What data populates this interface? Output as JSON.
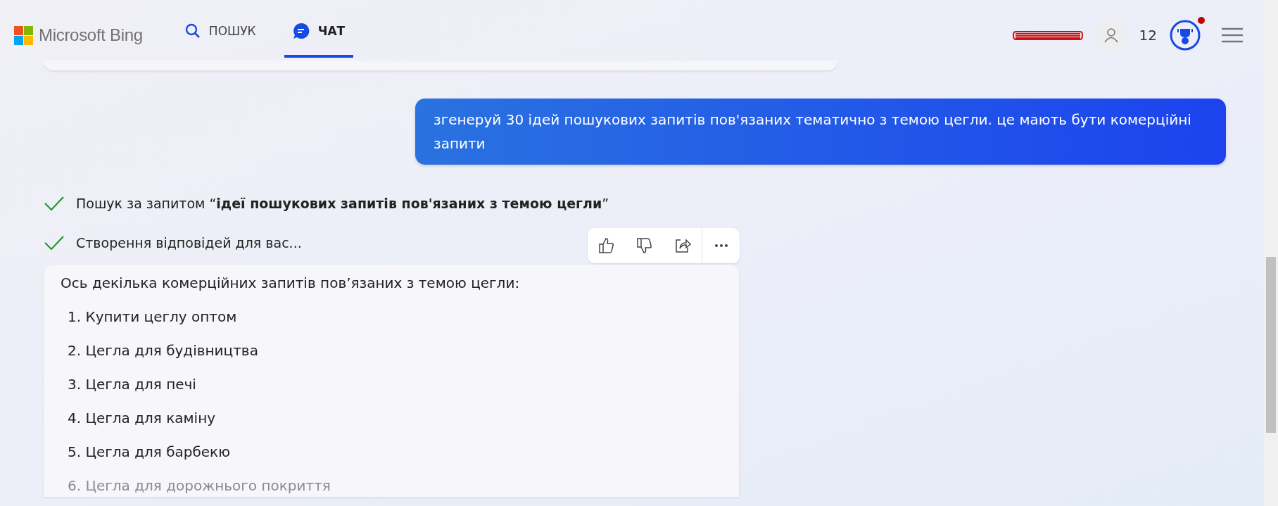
{
  "header": {
    "logo": "Microsoft Bing",
    "tabs": [
      {
        "label": "ПОШУК",
        "kind": "search",
        "selected": false
      },
      {
        "label": "ЧАТ",
        "kind": "chat",
        "selected": true
      }
    ],
    "points": "12",
    "rewards_notification": true
  },
  "user_message": "згенеруй 30 ідей пошукових запитів пов'язаних тематично з темою цегли. це мають бути комерційні запити",
  "progress": [
    {
      "text": "Пошук за запитом “**ідеї пошукових запитів пов'язаних з темою цегли**”",
      "done": true
    },
    {
      "text": "Створення відповідей для вас...",
      "done": true
    }
  ],
  "answer": {
    "intro": "Ось декілька комерційних запитів пов’язаних з темою цегли:",
    "items": [
      "1. Купити цеглу оптом",
      "2. Цегла для будівництва",
      "3. Цегла для печі",
      "4. Цегла для каміну",
      "5. Цегла для барбекю",
      "6. Цегла для дорожнього покриття"
    ]
  }
}
